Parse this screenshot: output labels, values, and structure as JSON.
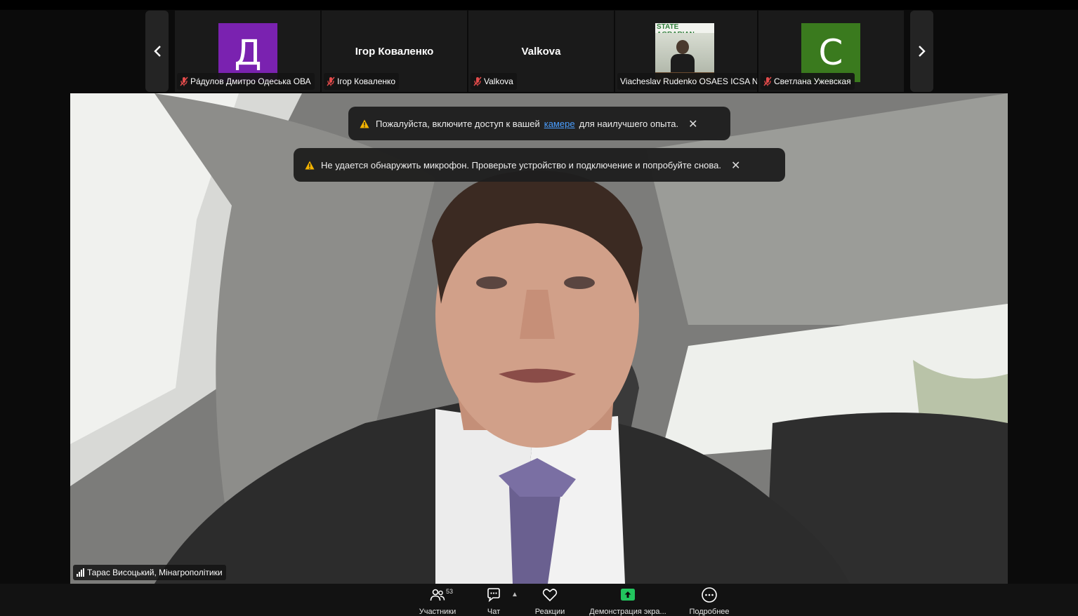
{
  "strip": {
    "participants": [
      {
        "name": "Рáдулов Дмитро Одеська ОВА",
        "initial": "Д",
        "color": "#7a22b0"
      },
      {
        "name": "Ігор Коваленко",
        "display": "Ігор Коваленко"
      },
      {
        "name": "Valkova",
        "display": "Valkova"
      },
      {
        "name": "Viacheslav Rudenko OSAES ICSA N...",
        "photo_text": "STATE AGRARIAN"
      },
      {
        "name": "Светлана Ужевская",
        "initial": "С",
        "color": "#3a7a1e"
      }
    ]
  },
  "main": {
    "speaker": "Тарас Висоцький, Мінагрополітики"
  },
  "notifications": {
    "camera_before": "Пожалуйста, включите доступ к вашей",
    "camera_link": "камере",
    "camera_after": "для наилучшего опыта.",
    "mic": "Не удается обнаружить микрофон. Проверьте устройство и подключение и попробуйте снова.",
    "close": "✕"
  },
  "toolbar": {
    "participants_label": "Участники",
    "participants_count": "53",
    "chat_label": "Чат",
    "reactions_label": "Реакции",
    "share_label": "Демонстрация экра...",
    "more_label": "Подробнее"
  },
  "colors": {
    "share_green": "#22c55e",
    "link_blue": "#4a9eff",
    "warning": "#f5b400"
  }
}
